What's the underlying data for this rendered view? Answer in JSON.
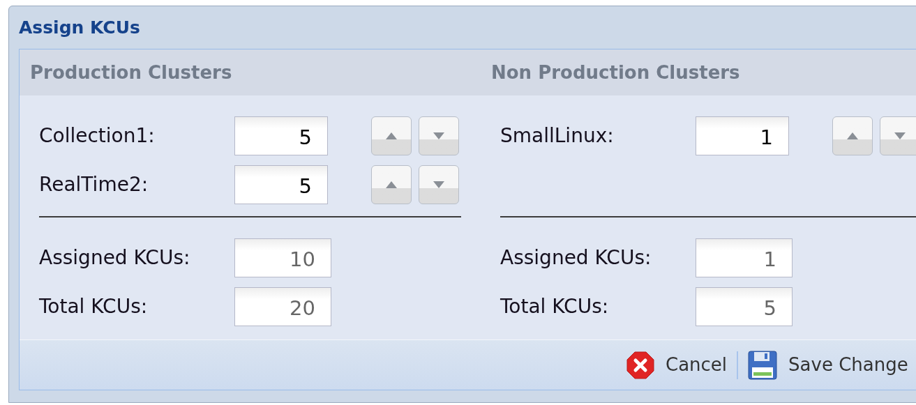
{
  "window": {
    "title": "Assign KCUs"
  },
  "sections": [
    {
      "header": "Production Clusters",
      "rows": [
        {
          "label": "Collection1:",
          "value": "5"
        },
        {
          "label": "RealTime2:",
          "value": "5"
        }
      ],
      "summary": [
        {
          "label": "Assigned KCUs:",
          "value": "10"
        },
        {
          "label": "Total KCUs:",
          "value": "20"
        }
      ]
    },
    {
      "header": "Non Production Clusters",
      "rows": [
        {
          "label": "SmallLinux:",
          "value": "1"
        }
      ],
      "summary": [
        {
          "label": "Assigned KCUs:",
          "value": "1"
        },
        {
          "label": "Total KCUs:",
          "value": "5"
        }
      ]
    }
  ],
  "buttons": [
    {
      "kind": "cancel",
      "label": "Cancel"
    },
    {
      "kind": "save",
      "label": "Save Change"
    }
  ]
}
